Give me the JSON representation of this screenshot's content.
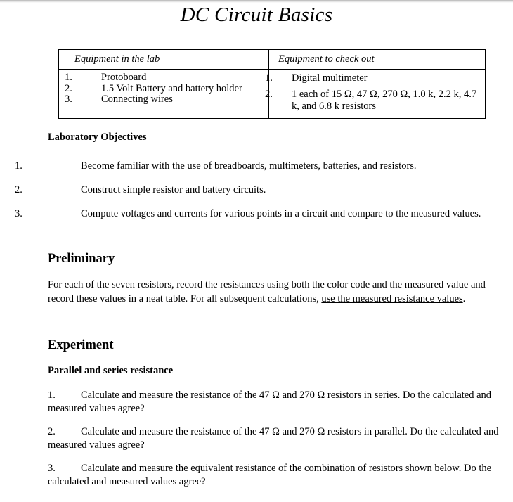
{
  "document": {
    "title": "DC Circuit Basics"
  },
  "equipment_table": {
    "columns": [
      {
        "header": "Equipment in the lab"
      },
      {
        "header": "Equipment to check out"
      }
    ],
    "lab_items": [
      {
        "num": "1.",
        "text": "Protoboard"
      },
      {
        "num": "2.",
        "text": "1.5 Volt Battery and battery holder"
      },
      {
        "num": "3.",
        "text": "Connecting wires"
      }
    ],
    "checkout_items": [
      {
        "num": "1.",
        "text": "Digital multimeter"
      },
      {
        "num": "2.",
        "text": "1 each of 15 Ω, 47 Ω, 270 Ω, 1.0 k, 2.2 k, 4.7 k, and 6.8 k resistors"
      }
    ]
  },
  "objectives": {
    "heading": "Laboratory Objectives",
    "items": [
      {
        "num": "1.",
        "text": "Become familiar with the use of breadboards, multimeters, batteries, and resistors."
      },
      {
        "num": "2.",
        "text": "Construct simple resistor and battery circuits."
      },
      {
        "num": "3.",
        "text": "Compute voltages and currents for various points in a circuit and compare to the measured values."
      }
    ]
  },
  "preliminary": {
    "heading": "Preliminary",
    "body_before": "For each of the seven resistors, record the resistances using both the color code and the measured value and record these values in a neat table.  For all subsequent calculations, ",
    "body_underlined": "use the measured resistance values",
    "body_after": "."
  },
  "experiment": {
    "heading": "Experiment",
    "subheading": "Parallel and series resistance",
    "items": [
      {
        "num": "1.",
        "text": "Calculate and measure the resistance of the 47 Ω and 270 Ω resistors in series.  Do the calculated and measured values agree?"
      },
      {
        "num": "2.",
        "text": "Calculate and measure the resistance of the 47 Ω and 270 Ω resistors in parallel.  Do the calculated and measured values agree?"
      },
      {
        "num": "3.",
        "text": "Calculate and measure the equivalent resistance of the combination of resistors shown below.  Do the calculated and measured values agree?"
      }
    ]
  }
}
